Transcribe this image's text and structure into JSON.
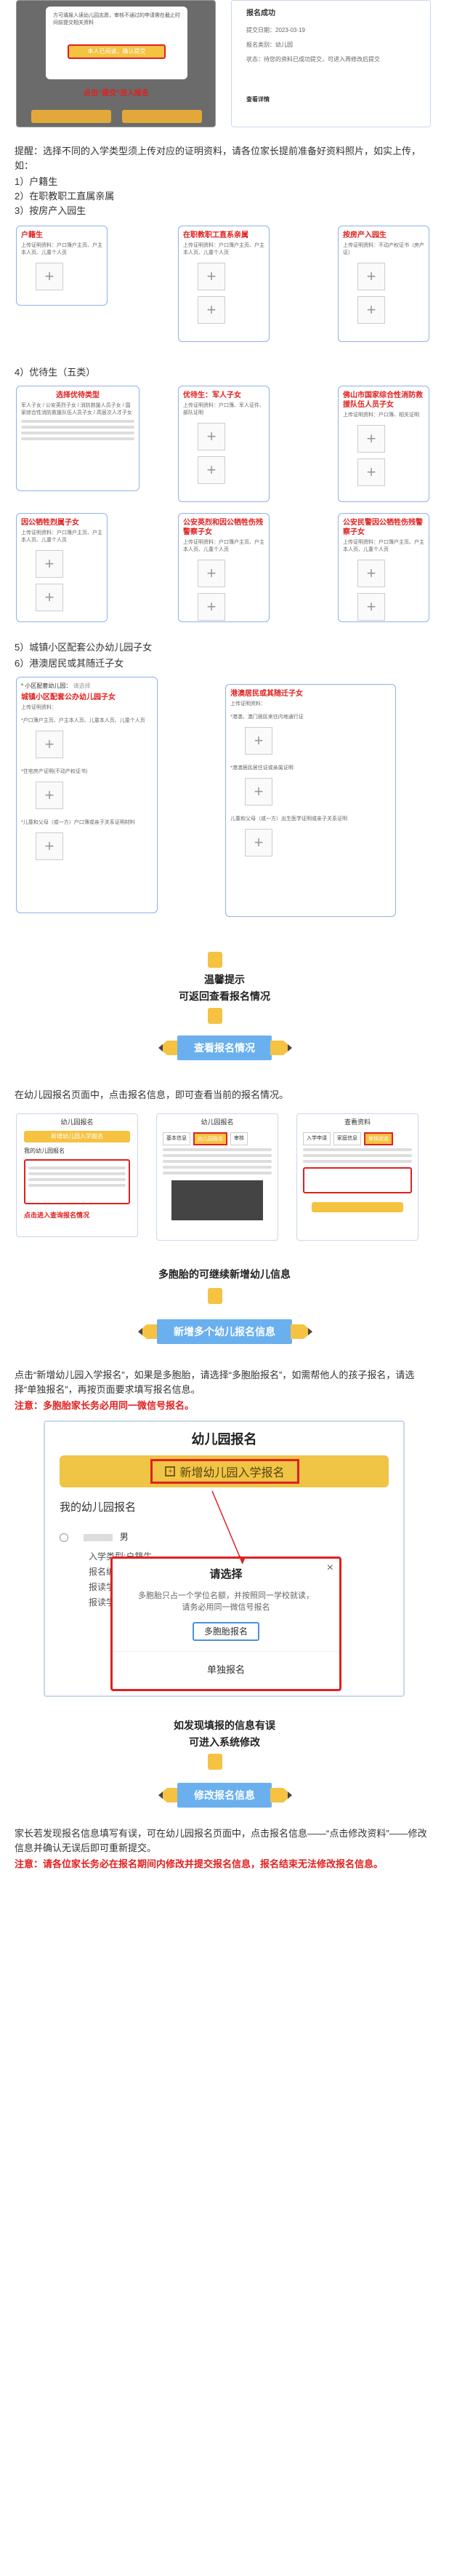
{
  "top_shot": {
    "modal_text": "方可填报入读幼儿园志愿，审核不通过的申请需在截止时间前提交相关资料",
    "confirm_label": "本人已阅读，确认提交",
    "red_note": "点击“提交”进入报名"
  },
  "right_shot": {
    "title": "报名成功",
    "rows": [
      {
        "label": "提交日期：",
        "value": "2023-03-19"
      },
      {
        "label": "报名类别：",
        "value": "幼儿园"
      },
      {
        "label": "状态：",
        "value": "待您的资料已成功提交，可进入再修改后提交"
      }
    ],
    "link": "查看详情"
  },
  "hint": {
    "line1": "提醒：选择不同的入学类型须上传对应的证明资料，请各位家长提前准备好资料照片，如实上传，如：",
    "items": [
      "1）户籍生",
      "2）在职教职工直属亲属",
      "3）按房产入园生"
    ],
    "item4": "4）优待生（五类）",
    "item5": "5）城镇小区配套公办幼儿园子女",
    "item6": "6）港澳居民或其随迁子女"
  },
  "cards_row1": [
    {
      "title": "户籍生",
      "sub": "上传证明资料：户口簿户主页、户主本人页、儿童个人页"
    },
    {
      "title": "在职教职工直系亲属",
      "sub": "上传证明资料：户口簿户主页、户主本人页、儿童个人页"
    },
    {
      "title": "按房产入园生",
      "sub": "上传证明资料：不动产权证书（房产证）"
    }
  ],
  "cards_row2": [
    {
      "title": "选择优待类型",
      "sub": "军人子女 / 公安英烈子女 / 消防救援人员子女 / 国家综合性消防救援队伍人员子女 / 高层次人才子女"
    },
    {
      "title": "优待生：军人子女",
      "sub": "上传证明资料：户口簿、军人证件、部队证明"
    },
    {
      "title": "佛山市国家综合性消防救援队伍人员子女",
      "sub": "上传证明资料：户口簿、相关证明"
    }
  ],
  "cards_row3": [
    {
      "title": "因公牺牲烈属子女",
      "sub": "上传证明资料：户口簿户主页、户主本人页、儿童个人页"
    },
    {
      "title": "公安英烈和因公牺牲伤残警察子女",
      "sub": "上传证明资料：户口簿户主页、户主本人页、儿童个人页"
    },
    {
      "title": "公安民警因公牺牲伤残警察子女",
      "sub": "上传证明资料：户口簿户主页、户主本人页、儿童个人页"
    }
  ],
  "card_town": {
    "head": "* 小区配套幼儿园：",
    "placeholder": "请选择",
    "title": "城镇小区配套公办幼儿园子女",
    "upload": "上传证明资料：",
    "items": [
      "*户口簿户主页、户主本人页、儿童本人页、儿童个人页",
      "*住宅房产证明(不动产权证书)",
      "*儿童和父母（或一方）户口簿或亲子关系证明材料"
    ]
  },
  "card_hk": {
    "title": "港澳居民或其随迁子女",
    "upload": "上传证明资料：",
    "items": [
      "*港澳、澳门居民来往内地通行证",
      "*港澳居民居住证或亲属证明",
      "儿童和父母（或一方）出生医学证明或亲子关系证明"
    ]
  },
  "tip1": {
    "text1": "温馨提示",
    "text2": "可返回查看报名情况",
    "button": "查看报名情况"
  },
  "para2": "在幼儿园报名页面中，点击报名信息，即可查看当前的报名情况。",
  "phone1": {
    "title": "幼儿园报名",
    "add": "新增幼儿园入学报名",
    "section": "我的幼儿园报名",
    "red": "点击进入查询报名情况"
  },
  "phone2": {
    "title": "幼儿园报名",
    "tabs": [
      "基本信息",
      "幼儿园报名",
      "审核"
    ]
  },
  "phone3": {
    "title": "查看资料",
    "tabs": [
      "入学申请",
      "家庭信息",
      "审核状态"
    ]
  },
  "tip2": {
    "text": "多胞胎的可继续新增幼儿信息",
    "button": "新增多个幼儿报名信息"
  },
  "para3": "点击“新增幼儿园入学报名”，如果是多胞胎，请选择“多胞胎报名”，如需帮他人的孩子报名，请选择“单独报名”，再按页面要求填写报名信息。",
  "note3": "注意：多胞胎家长务必用同一微信号报名。",
  "big_phone": {
    "title": "幼儿园报名",
    "add": "新增幼儿园入学报名",
    "section": "我的幼儿园报名",
    "child": "男",
    "rows": [
      "入学类型:户籍生",
      "报名编号:（图文遮挡）",
      "报读学校:（图文遮挡园）",
      "报读学校:（图文遮挡）"
    ],
    "dialog_title": "请选择",
    "dialog_text": "多胞胎只占一个学位名额，并按照同一学校就读，请务必用同一微信号报名",
    "btn_multi": "多胞胎报名",
    "btn_single": "单独报名",
    "close": "×"
  },
  "tip3": {
    "text1": "如发现填报的信息有误",
    "text2": "可进入系统修改",
    "button": "修改报名信息"
  },
  "para4": "家长若发现报名信息填写有误，可在幼儿园报名页面中，点击报名信息——“点击修改资料”——修改信息并确认无误后即可重新提交。",
  "note4": "注意：请各位家长务必在报名期间内修改并提交报名信息，报名结束无法修改报名信息。",
  "colors": {
    "blue": "#6ab0ef",
    "red": "#e02020",
    "gold": "#f5c242"
  }
}
